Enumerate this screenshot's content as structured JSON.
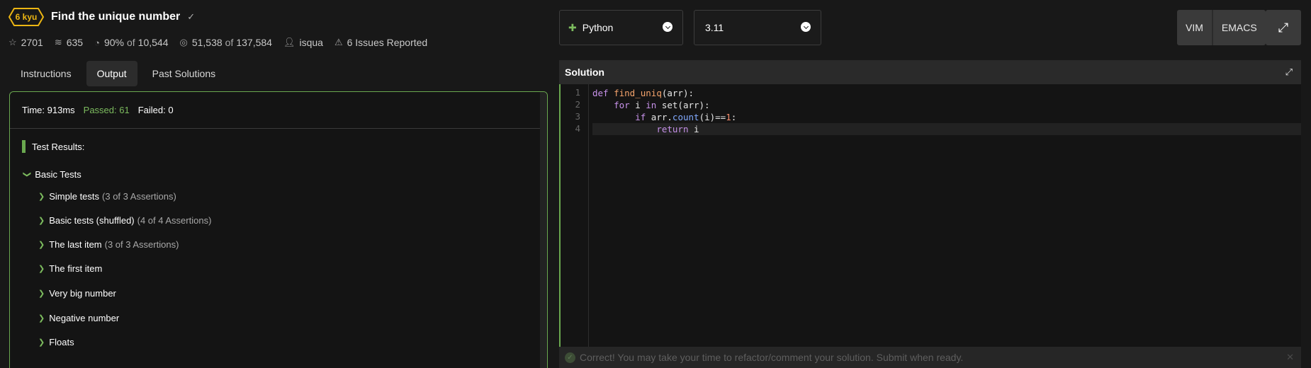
{
  "kata": {
    "rank": "6 kyu",
    "title": "Find the unique number",
    "stats": {
      "stars": "2701",
      "collections": "635",
      "satisfaction": "90%",
      "satisfaction_of": "of",
      "votes": "10,544",
      "completed": "51,538",
      "completed_of": "of",
      "attempted": "137,584",
      "author": "isqua",
      "issues": "6 Issues Reported"
    }
  },
  "tabs": [
    "Instructions",
    "Output",
    "Past Solutions"
  ],
  "active_tab": "Output",
  "results": {
    "time": "Time: 913ms",
    "passed": "Passed: 61",
    "failed": "Failed: 0",
    "title": "Test Results:",
    "group": "Basic Tests",
    "tests": [
      {
        "name": "Simple tests",
        "assertions": "(3 of 3 Assertions)"
      },
      {
        "name": "Basic tests (shuffled)",
        "assertions": "(4 of 4 Assertions)"
      },
      {
        "name": "The last item",
        "assertions": "(3 of 3 Assertions)"
      },
      {
        "name": "The first item",
        "assertions": ""
      },
      {
        "name": "Very big number",
        "assertions": ""
      },
      {
        "name": "Negative number",
        "assertions": ""
      },
      {
        "name": "Floats",
        "assertions": ""
      }
    ]
  },
  "language": {
    "name": "Python",
    "version": "3.11"
  },
  "modes": [
    "VIM",
    "EMACS"
  ],
  "editor": {
    "title": "Solution",
    "line_numbers": [
      "1",
      "2",
      "3",
      "4"
    ],
    "lines": [
      [
        {
          "t": "def ",
          "c": "kw"
        },
        {
          "t": "find_uniq",
          "c": "fn"
        },
        {
          "t": "(arr):",
          "c": ""
        }
      ],
      [
        {
          "t": "    ",
          "c": ""
        },
        {
          "t": "for",
          "c": "kw"
        },
        {
          "t": " i ",
          "c": ""
        },
        {
          "t": "in",
          "c": "kw"
        },
        {
          "t": " set(arr):",
          "c": ""
        }
      ],
      [
        {
          "t": "        ",
          "c": ""
        },
        {
          "t": "if",
          "c": "kw"
        },
        {
          "t": " arr.",
          "c": ""
        },
        {
          "t": "count",
          "c": "mt"
        },
        {
          "t": "(i)==",
          "c": ""
        },
        {
          "t": "1",
          "c": "nm"
        },
        {
          "t": ":",
          "c": ""
        }
      ],
      [
        {
          "t": "            ",
          "c": ""
        },
        {
          "t": "return",
          "c": "kw"
        },
        {
          "t": " i",
          "c": ""
        }
      ]
    ]
  },
  "toast": "Correct! You may take your time to refactor/comment your solution. Submit when ready.",
  "colors": {
    "accent": "#6aa84f",
    "rank": "#ecb613",
    "passed": "#7cbb5e"
  }
}
